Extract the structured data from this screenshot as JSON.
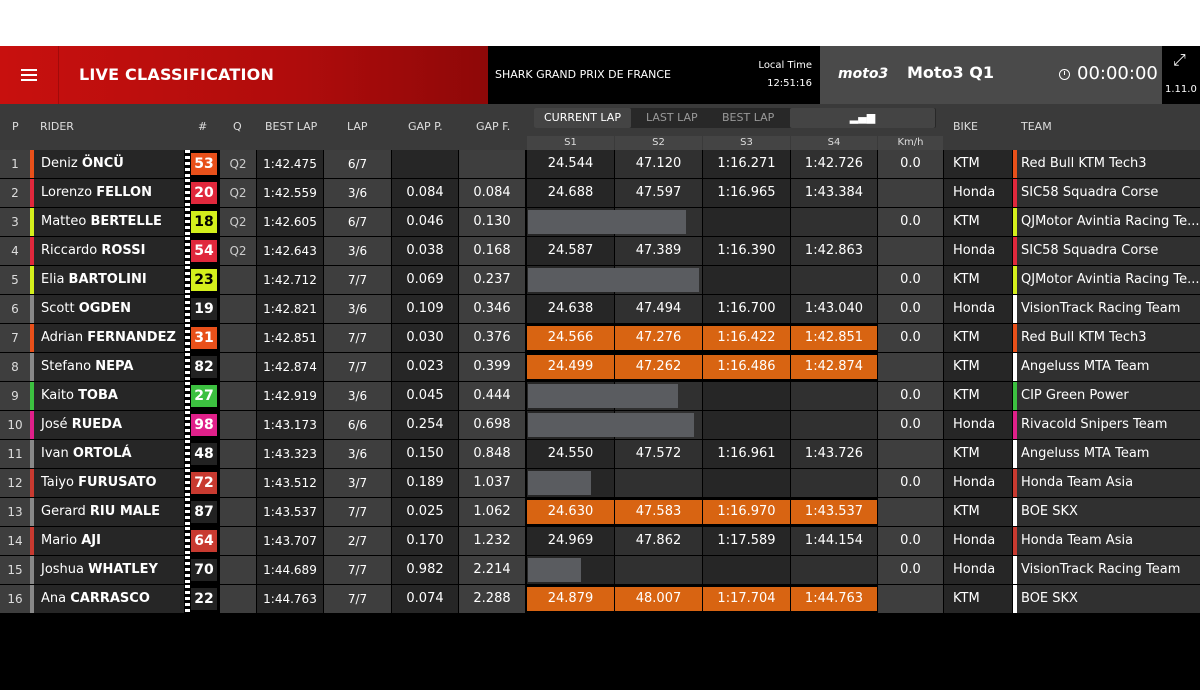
{
  "header": {
    "title": "LIVE CLASSIFICATION",
    "event": "SHARK GRAND PRIX DE FRANCE",
    "local_time_label": "Local Time",
    "local_time": "12:51:16",
    "logo": "moto3",
    "session": "Moto3 Q1",
    "timer": "00:00:00",
    "version": "1.11.0"
  },
  "columns": {
    "p": "P",
    "rider": "RIDER",
    "num": "#",
    "q": "Q",
    "best_lap": "BEST LAP",
    "lap": "LAP",
    "gap_p": "GAP P.",
    "gap_f": "GAP F.",
    "bike": "BIKE",
    "team": "TEAM",
    "s1": "S1",
    "s2": "S2",
    "s3": "S3",
    "s4": "S4",
    "kmh": "Km/h"
  },
  "lap_tabs": {
    "current": "CURRENT LAP",
    "last": "LAST LAP",
    "best": "BEST LAP",
    "chart_icon": "bar-chart-icon"
  },
  "colors": {
    "orange": "#d86412",
    "header_red": "#c8100e"
  },
  "rows": [
    {
      "p": "1",
      "first": "Deniz",
      "last": "ÖNCÜ",
      "num": "53",
      "numbg": "#e8501a",
      "numfg": "#fff",
      "strip": "#e8501a",
      "q": "Q2",
      "best": "1:42.475",
      "lap": "6/7",
      "gap_p": "",
      "gap_f": "",
      "s1": "24.544",
      "s2": "47.120",
      "s3": "1:16.271",
      "s4": "1:42.726",
      "kmh": "0.0",
      "bike": "KTM",
      "team": "Red Bull KTM Tech3",
      "tstrip": "#e8501a",
      "orange": false,
      "bar": 0
    },
    {
      "p": "2",
      "first": "Lorenzo",
      "last": "FELLON",
      "num": "20",
      "numbg": "#e0283c",
      "numfg": "#fff",
      "strip": "#e0283c",
      "q": "Q2",
      "best": "1:42.559",
      "lap": "3/6",
      "gap_p": "0.084",
      "gap_f": "0.084",
      "s1": "24.688",
      "s2": "47.597",
      "s3": "1:16.965",
      "s4": "1:43.384",
      "kmh": "",
      "bike": "Honda",
      "team": "SIC58 Squadra Corse",
      "tstrip": "#e0283c",
      "orange": false,
      "bar": 0
    },
    {
      "p": "3",
      "first": "Matteo",
      "last": "BERTELLE",
      "num": "18",
      "numbg": "#d4ef1c",
      "numfg": "#000",
      "strip": "#d4ef1c",
      "q": "Q2",
      "best": "1:42.605",
      "lap": "6/7",
      "gap_p": "0.046",
      "gap_f": "0.130",
      "s1": "",
      "s2": "",
      "s3": "",
      "s4": "",
      "kmh": "0.0",
      "bike": "KTM",
      "team": "QJMotor Avintia Racing Te...",
      "tstrip": "#d4ef1c",
      "orange": false,
      "bar": 0.6
    },
    {
      "p": "4",
      "first": "Riccardo",
      "last": "ROSSI",
      "num": "54",
      "numbg": "#e0283c",
      "numfg": "#fff",
      "strip": "#e0283c",
      "q": "Q2",
      "best": "1:42.643",
      "lap": "3/6",
      "gap_p": "0.038",
      "gap_f": "0.168",
      "s1": "24.587",
      "s2": "47.389",
      "s3": "1:16.390",
      "s4": "1:42.863",
      "kmh": "",
      "bike": "Honda",
      "team": "SIC58 Squadra Corse",
      "tstrip": "#e0283c",
      "orange": false,
      "bar": 0
    },
    {
      "p": "5",
      "first": "Elia",
      "last": "BARTOLINI",
      "num": "23",
      "numbg": "#d4ef1c",
      "numfg": "#000",
      "strip": "#d4ef1c",
      "q": "",
      "best": "1:42.712",
      "lap": "7/7",
      "gap_p": "0.069",
      "gap_f": "0.237",
      "s1": "",
      "s2": "",
      "s3": "",
      "s4": "",
      "kmh": "0.0",
      "bike": "KTM",
      "team": "QJMotor Avintia Racing Te...",
      "tstrip": "#d4ef1c",
      "orange": false,
      "bar": 0.65
    },
    {
      "p": "6",
      "first": "Scott",
      "last": "OGDEN",
      "num": "19",
      "numbg": "#222",
      "numfg": "#fff",
      "strip": "#888",
      "q": "",
      "best": "1:42.821",
      "lap": "3/6",
      "gap_p": "0.109",
      "gap_f": "0.346",
      "s1": "24.638",
      "s2": "47.494",
      "s3": "1:16.700",
      "s4": "1:43.040",
      "kmh": "0.0",
      "bike": "Honda",
      "team": "VisionTrack Racing Team",
      "tstrip": "#ffffff",
      "orange": false,
      "bar": 0
    },
    {
      "p": "7",
      "first": "Adrian",
      "last": "FERNANDEZ",
      "num": "31",
      "numbg": "#e8501a",
      "numfg": "#fff",
      "strip": "#e8501a",
      "q": "",
      "best": "1:42.851",
      "lap": "7/7",
      "gap_p": "0.030",
      "gap_f": "0.376",
      "s1": "24.566",
      "s2": "47.276",
      "s3": "1:16.422",
      "s4": "1:42.851",
      "kmh": "0.0",
      "bike": "KTM",
      "team": "Red Bull KTM Tech3",
      "tstrip": "#e8501a",
      "orange": true,
      "bar": 0
    },
    {
      "p": "8",
      "first": "Stefano",
      "last": "NEPA",
      "num": "82",
      "numbg": "#222",
      "numfg": "#fff",
      "strip": "#888",
      "q": "",
      "best": "1:42.874",
      "lap": "7/7",
      "gap_p": "0.023",
      "gap_f": "0.399",
      "s1": "24.499",
      "s2": "47.262",
      "s3": "1:16.486",
      "s4": "1:42.874",
      "kmh": "",
      "bike": "KTM",
      "team": "Angeluss MTA Team",
      "tstrip": "#ffffff",
      "orange": true,
      "bar": 0
    },
    {
      "p": "9",
      "first": "Kaito",
      "last": "TOBA",
      "num": "27",
      "numbg": "#3cc040",
      "numfg": "#fff",
      "strip": "#3cc040",
      "q": "",
      "best": "1:42.919",
      "lap": "3/6",
      "gap_p": "0.045",
      "gap_f": "0.444",
      "s1": "",
      "s2": "",
      "s3": "",
      "s4": "",
      "kmh": "0.0",
      "bike": "KTM",
      "team": "CIP Green Power",
      "tstrip": "#3cc040",
      "orange": false,
      "bar": 0.57
    },
    {
      "p": "10",
      "first": "José",
      "last": "RUEDA",
      "num": "98",
      "numbg": "#e0208a",
      "numfg": "#fff",
      "strip": "#e0208a",
      "q": "",
      "best": "1:43.173",
      "lap": "6/6",
      "gap_p": "0.254",
      "gap_f": "0.698",
      "s1": "",
      "s2": "",
      "s3": "",
      "s4": "",
      "kmh": "0.0",
      "bike": "Honda",
      "team": "Rivacold Snipers Team",
      "tstrip": "#e0208a",
      "orange": false,
      "bar": 0.63
    },
    {
      "p": "11",
      "first": "Ivan",
      "last": "ORTOLÁ",
      "num": "48",
      "numbg": "#222",
      "numfg": "#fff",
      "strip": "#888",
      "q": "",
      "best": "1:43.323",
      "lap": "3/6",
      "gap_p": "0.150",
      "gap_f": "0.848",
      "s1": "24.550",
      "s2": "47.572",
      "s3": "1:16.961",
      "s4": "1:43.726",
      "kmh": "",
      "bike": "KTM",
      "team": "Angeluss MTA Team",
      "tstrip": "#ffffff",
      "orange": false,
      "bar": 0
    },
    {
      "p": "12",
      "first": "Taiyo",
      "last": "FURUSATO",
      "num": "72",
      "numbg": "#c83a30",
      "numfg": "#fff",
      "strip": "#c83a30",
      "q": "",
      "best": "1:43.512",
      "lap": "3/7",
      "gap_p": "0.189",
      "gap_f": "1.037",
      "s1": "",
      "s2": "",
      "s3": "",
      "s4": "",
      "kmh": "0.0",
      "bike": "Honda",
      "team": "Honda Team Asia",
      "tstrip": "#c83a30",
      "orange": false,
      "bar": 0.24
    },
    {
      "p": "13",
      "first": "Gerard",
      "last": "RIU MALE",
      "num": "87",
      "numbg": "#222",
      "numfg": "#fff",
      "strip": "#888",
      "q": "",
      "best": "1:43.537",
      "lap": "7/7",
      "gap_p": "0.025",
      "gap_f": "1.062",
      "s1": "24.630",
      "s2": "47.583",
      "s3": "1:16.970",
      "s4": "1:43.537",
      "kmh": "",
      "bike": "KTM",
      "team": "BOE SKX",
      "tstrip": "#ffffff",
      "orange": true,
      "bar": 0
    },
    {
      "p": "14",
      "first": "Mario",
      "last": "AJI",
      "num": "64",
      "numbg": "#c83a30",
      "numfg": "#fff",
      "strip": "#c83a30",
      "q": "",
      "best": "1:43.707",
      "lap": "2/7",
      "gap_p": "0.170",
      "gap_f": "1.232",
      "s1": "24.969",
      "s2": "47.862",
      "s3": "1:17.589",
      "s4": "1:44.154",
      "kmh": "0.0",
      "bike": "Honda",
      "team": "Honda Team Asia",
      "tstrip": "#c83a30",
      "orange": false,
      "bar": 0
    },
    {
      "p": "15",
      "first": "Joshua",
      "last": "WHATLEY",
      "num": "70",
      "numbg": "#222",
      "numfg": "#fff",
      "strip": "#888",
      "q": "",
      "best": "1:44.689",
      "lap": "7/7",
      "gap_p": "0.982",
      "gap_f": "2.214",
      "s1": "",
      "s2": "",
      "s3": "",
      "s4": "",
      "kmh": "0.0",
      "bike": "Honda",
      "team": "VisionTrack Racing Team",
      "tstrip": "#ffffff",
      "orange": false,
      "bar": 0.2
    },
    {
      "p": "16",
      "first": "Ana",
      "last": "CARRASCO",
      "num": "22",
      "numbg": "#222",
      "numfg": "#fff",
      "strip": "#888",
      "q": "",
      "best": "1:44.763",
      "lap": "7/7",
      "gap_p": "0.074",
      "gap_f": "2.288",
      "s1": "24.879",
      "s2": "48.007",
      "s3": "1:17.704",
      "s4": "1:44.763",
      "kmh": "",
      "bike": "KTM",
      "team": "BOE SKX",
      "tstrip": "#ffffff",
      "orange": true,
      "bar": 0
    }
  ]
}
